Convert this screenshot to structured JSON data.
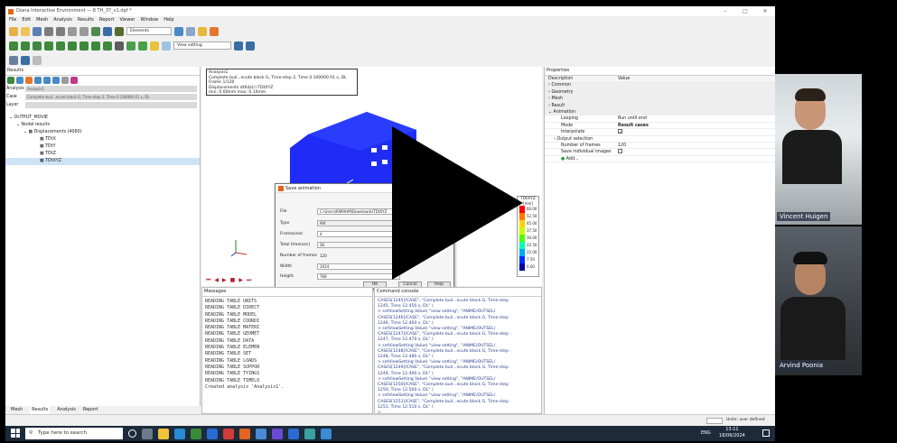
{
  "window": {
    "title": "Diana Interactive Environment — 8 TH_37_v1.dpf *"
  },
  "menu": [
    "File",
    "Edit",
    "Mesh",
    "Analysis",
    "Results",
    "Report",
    "Viewer",
    "Window",
    "Help"
  ],
  "toolbar": {
    "mode_dropdown": "Elements",
    "view_setting": "View setting"
  },
  "results_panel": {
    "title": "Results",
    "analysis_label": "Analysis",
    "analysis_value": "Analysis1",
    "case_label": "Case",
    "case_value": "Complete buil...ecute block G, Time-step 2, Time 0.100000 01 s, DL",
    "layer_label": "Layer",
    "tree": [
      "OUTPUT_MOVIE",
      "Nodal results",
      "Displacements (4060)",
      "TDtX",
      "TDtY",
      "TDtZ",
      "TDtXYZ"
    ]
  },
  "viewport": {
    "info_lines": [
      "Analysis1",
      "Complete buil...ecute block G, Time-step 2, Time 0.100000 01 s, DL",
      "Frame 1/120",
      "Displacements dtXdz(r) TDtXYZ",
      "min: 0.00mm max: 0.14mm"
    ],
    "legend_title": "TDtXYZ",
    "legend_unit": "[mm]",
    "legend_values": [
      "60.00",
      "52.50",
      "45.00",
      "37.50",
      "30.00",
      "22.50",
      "15.00",
      "7.50",
      "0.00"
    ],
    "legend_colors": [
      "#ff0000",
      "#ff7a00",
      "#ffd400",
      "#c8ff00",
      "#4cff00",
      "#00ffb0",
      "#00a8ff",
      "#0030ff",
      "#0000a0"
    ]
  },
  "dialog": {
    "title": "Save animation",
    "fields": [
      {
        "label": "File",
        "value": "C:\\Users\\RIMAHM\\Downloads\\TDtXYZ"
      },
      {
        "label": "Type",
        "value": "AVI"
      },
      {
        "label": "Frames/sec",
        "value": "4"
      },
      {
        "label": "Total time(sec)",
        "value": "30"
      },
      {
        "label": "Number of frames",
        "value": "120"
      },
      {
        "label": "Width",
        "value": "1024"
      },
      {
        "label": "Height",
        "value": "768"
      }
    ],
    "ok": "OK",
    "cancel": "Cancel",
    "help": "Help"
  },
  "messages": {
    "title": "Messages",
    "lines": [
      "READING TABLE UNITS",
      "READING TABLE DIRECT",
      "READING TABLE MODEL",
      "READING TABLE COORDI",
      "READING TABLE MATERI",
      "READING TABLE GEOMET",
      "READING TABLE DATA",
      "READING TABLE ELEMEN",
      "READING TABLE SET",
      "READING TABLE LOADS",
      "READING TABLE SUPPOR",
      "READING TABLE TYINGS",
      "READING TABLE TIMELO",
      "Created analysis 'Analysis1'."
    ]
  },
  "commands": {
    "title": "Command console",
    "lines": [
      "CASES[1245]/CASE\", \"Complete buil...ecute block G, Time-step",
      "1245, Time 12.450 s, DL\" )",
      "> setViewSetting Value( \"view setting\", \"ANIME/OUTSEL/",
      "CASES[1246]/CASE\", \"Complete buil...ecute block G, Time-step",
      "1246, Time 12.460 s, DL\" )",
      "> setViewSetting Value( \"view setting\", \"ANIME/OUTSEL/",
      "CASES[1247]/CASE\", \"Complete buil...ecute block G, Time-step",
      "1247, Time 12.470 s, DL\" )",
      "> setViewSetting Value( \"view setting\", \"ANIME/OUTSEL/",
      "CASES[1248]/CASE\", \"Complete buil...ecute block G, Time-step",
      "1248, Time 12.480 s, DL\" )",
      "> setViewSetting Value( \"view setting\", \"ANIME/OUTSEL/",
      "CASES[1249]/CASE\", \"Complete buil...ecute block G, Time-step",
      "1249, Time 12.490 s, DL\" )",
      "> setViewSetting Value( \"view setting\", \"ANIME/OUTSEL/",
      "CASES[1250]/CASE\", \"Complete buil...ecute block G, Time-step",
      "1250, Time 12.500 s, DL\" )",
      "> setViewSetting Value( \"view setting\", \"ANIME/OUTSEL/",
      "CASES[1251]/CASE\", \"Complete buil...ecute block G, Time-step",
      "1251, Time 12.510 s, DL\" )",
      ">"
    ]
  },
  "properties": {
    "title": "Properties",
    "col_description": "Description",
    "col_value": "Value",
    "groups": [
      "Common",
      "Geometry",
      "Mesh",
      "Result",
      "Animation"
    ],
    "rows": [
      {
        "k": "Looping",
        "v": "Run until end"
      },
      {
        "k": "Mode",
        "v": "Result cases"
      },
      {
        "k": "Interpolate",
        "v": ""
      },
      {
        "k": "Output selection",
        "v": ""
      },
      {
        "k": "Number of frames",
        "v": "120"
      },
      {
        "k": "Save individual images",
        "v": ""
      },
      {
        "k": "Add...",
        "v": ""
      }
    ]
  },
  "bottom_tabs": [
    "Mesh",
    "Results",
    "Analysis",
    "Report"
  ],
  "status": {
    "units": "Units: user defined"
  },
  "taskbar": {
    "search_placeholder": "Type here to search",
    "time": "13:11",
    "date": "18/06/2024",
    "lang": "ENG"
  },
  "participants": [
    {
      "name": "Vincent Huigen"
    },
    {
      "name": "Arvind Poonia"
    }
  ]
}
